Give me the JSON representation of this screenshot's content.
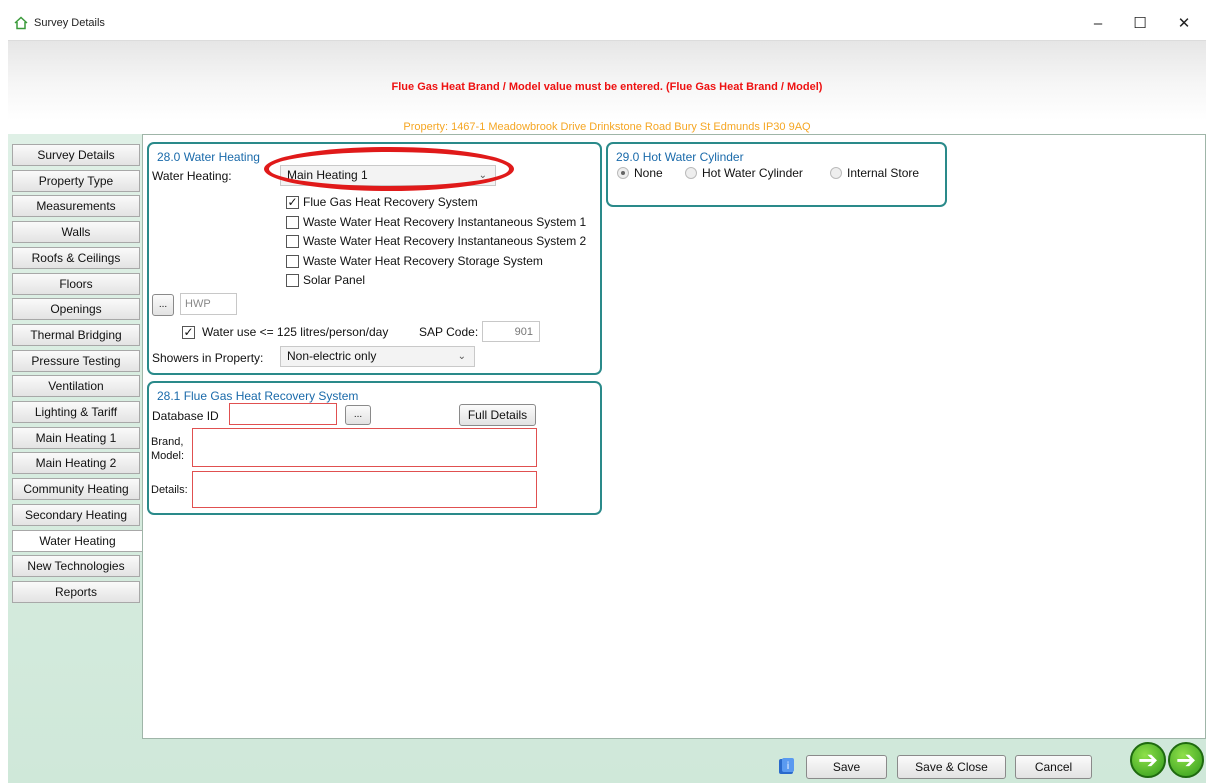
{
  "window": {
    "title": "Survey Details",
    "controls": {
      "minimize": "–",
      "maximize": "☐",
      "close": "✕"
    }
  },
  "banner": {
    "error_message": "Flue Gas Heat Brand / Model value must be entered. (Flue Gas Heat Brand / Model)"
  },
  "property": "Property: 1467-1 Meadowbrook Drive  Drinkstone Road Bury St Edmunds IP30 9AQ",
  "tabs": [
    "Survey Details",
    "Property Type",
    "Measurements",
    "Walls",
    "Roofs & Ceilings",
    "Floors",
    "Openings",
    "Thermal Bridging",
    "Pressure Testing",
    "Ventilation",
    "Lighting & Tariff",
    "Main Heating 1",
    "Main Heating 2",
    "Community Heating",
    "Secondary Heating",
    "Water Heating",
    "New Technologies",
    "Reports"
  ],
  "active_tab": "Water Heating",
  "water_heating": {
    "title": "28.0 Water Heating",
    "water_heating_label": "Water Heating:",
    "water_heating_value": "Main Heating 1",
    "options": [
      {
        "label": "Flue Gas Heat Recovery System",
        "checked": true
      },
      {
        "label": "Waste Water Heat Recovery Instantaneous System 1",
        "checked": false
      },
      {
        "label": "Waste Water Heat Recovery Instantaneous System 2",
        "checked": false
      },
      {
        "label": "Waste Water Heat Recovery Storage System",
        "checked": false
      },
      {
        "label": "Solar Panel",
        "checked": false
      }
    ],
    "browse_label": "...",
    "hwp_placeholder": "HWP",
    "water_use_label": "Water use <= 125 litres/person/day",
    "water_use_checked": true,
    "sap_code_label": "SAP Code:",
    "sap_code_value": "901",
    "showers_label": "Showers in Property:",
    "showers_value": "Non-electric only"
  },
  "hot_water_cylinder": {
    "title": "29.0 Hot Water Cylinder",
    "options": [
      "None",
      "Hot Water Cylinder",
      "Internal Store"
    ],
    "selected": "None"
  },
  "fghrs": {
    "title": "28.1 Flue Gas Heat Recovery System",
    "database_id_label": "Database ID",
    "database_id_value": "",
    "browse_label": "...",
    "full_details_label": "Full Details",
    "brand_label_line1": "Brand,",
    "brand_label_line2": "Model:",
    "brand_value": "",
    "details_label": "Details:",
    "details_value": ""
  },
  "footer": {
    "save_label": "Save",
    "save_close_label": "Save & Close",
    "cancel_label": "Cancel"
  },
  "colors": {
    "error_text": "#ee1111",
    "property_text": "#f5a623",
    "group_border": "#2a8a8a",
    "group_title": "#1a6aaa",
    "annotation": "#e01a1a"
  }
}
